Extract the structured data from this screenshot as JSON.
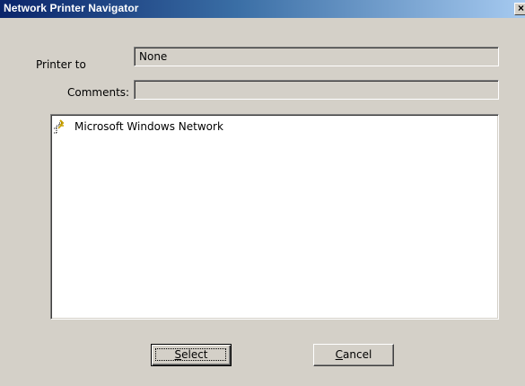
{
  "window": {
    "title": "Network Printer Navigator",
    "close_glyph": "×"
  },
  "form": {
    "printer_to_label": "Printer to",
    "printer_to_value": "None",
    "comments_label": "Comments:",
    "comments_value": ""
  },
  "tree": {
    "items": [
      {
        "label": "Microsoft Windows Network",
        "icon": "network-icon"
      }
    ]
  },
  "buttons": {
    "select": {
      "mnemonic": "S",
      "rest": "elect"
    },
    "cancel": {
      "mnemonic": "C",
      "rest": "ancel"
    }
  }
}
